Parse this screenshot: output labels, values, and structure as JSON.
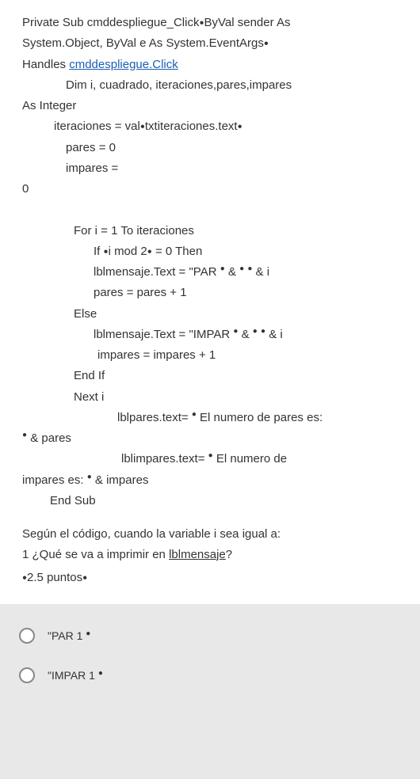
{
  "code": {
    "l1a": "Private Sub cmddespliegue_Click",
    "l1b": "ByVal sender As",
    "l2a": "System.Object, ByVal e As System.EventArgs",
    "l3a": "Handles ",
    "l3link": "cmddespliegue.Click",
    "l4": "Dim i, cuadrado, iteraciones,pares,impares",
    "l5": "As Integer",
    "l6a": "iteraciones = val",
    "l6b": "txtiteraciones.text",
    "l7": "pares = 0",
    "l8": "impares =",
    "l9": "0",
    "l10": "For i = 1 To iteraciones",
    "l11a": "If ",
    "l11b": "i mod 2",
    "l11c": " = 0 Then",
    "l12a": "lblmensaje.Text = \"PAR ",
    "l12b": "  &  ",
    "l12c": "  & i",
    "l13": "pares = pares + 1",
    "l14": "Else",
    "l15a": "lblmensaje.Text = \"IMPAR ",
    "l15b": "  &  ",
    "l15c": "  & i",
    "l16": "impares = impares + 1",
    "l17": "End If",
    "l18": "Next i",
    "l19a": "lblpares.text= ",
    "l19b": " El numero de pares es:",
    "l20": " & pares",
    "l21a": "lblimpares.text= ",
    "l21b": " El numero de",
    "l22a": "impares es: ",
    "l22b": " & impares",
    "l23": "End Sub"
  },
  "question": {
    "line1": "Según el código, cuando la variable i sea igual a:",
    "line2a": "1 ¿Qué se va a imprimir en ",
    "line2_underline": "lblmensaje",
    "line2b": "?",
    "points": "2.5 puntos"
  },
  "answers": {
    "opt1": "\"PAR 1 ",
    "opt2": "\"IMPAR 1 "
  }
}
